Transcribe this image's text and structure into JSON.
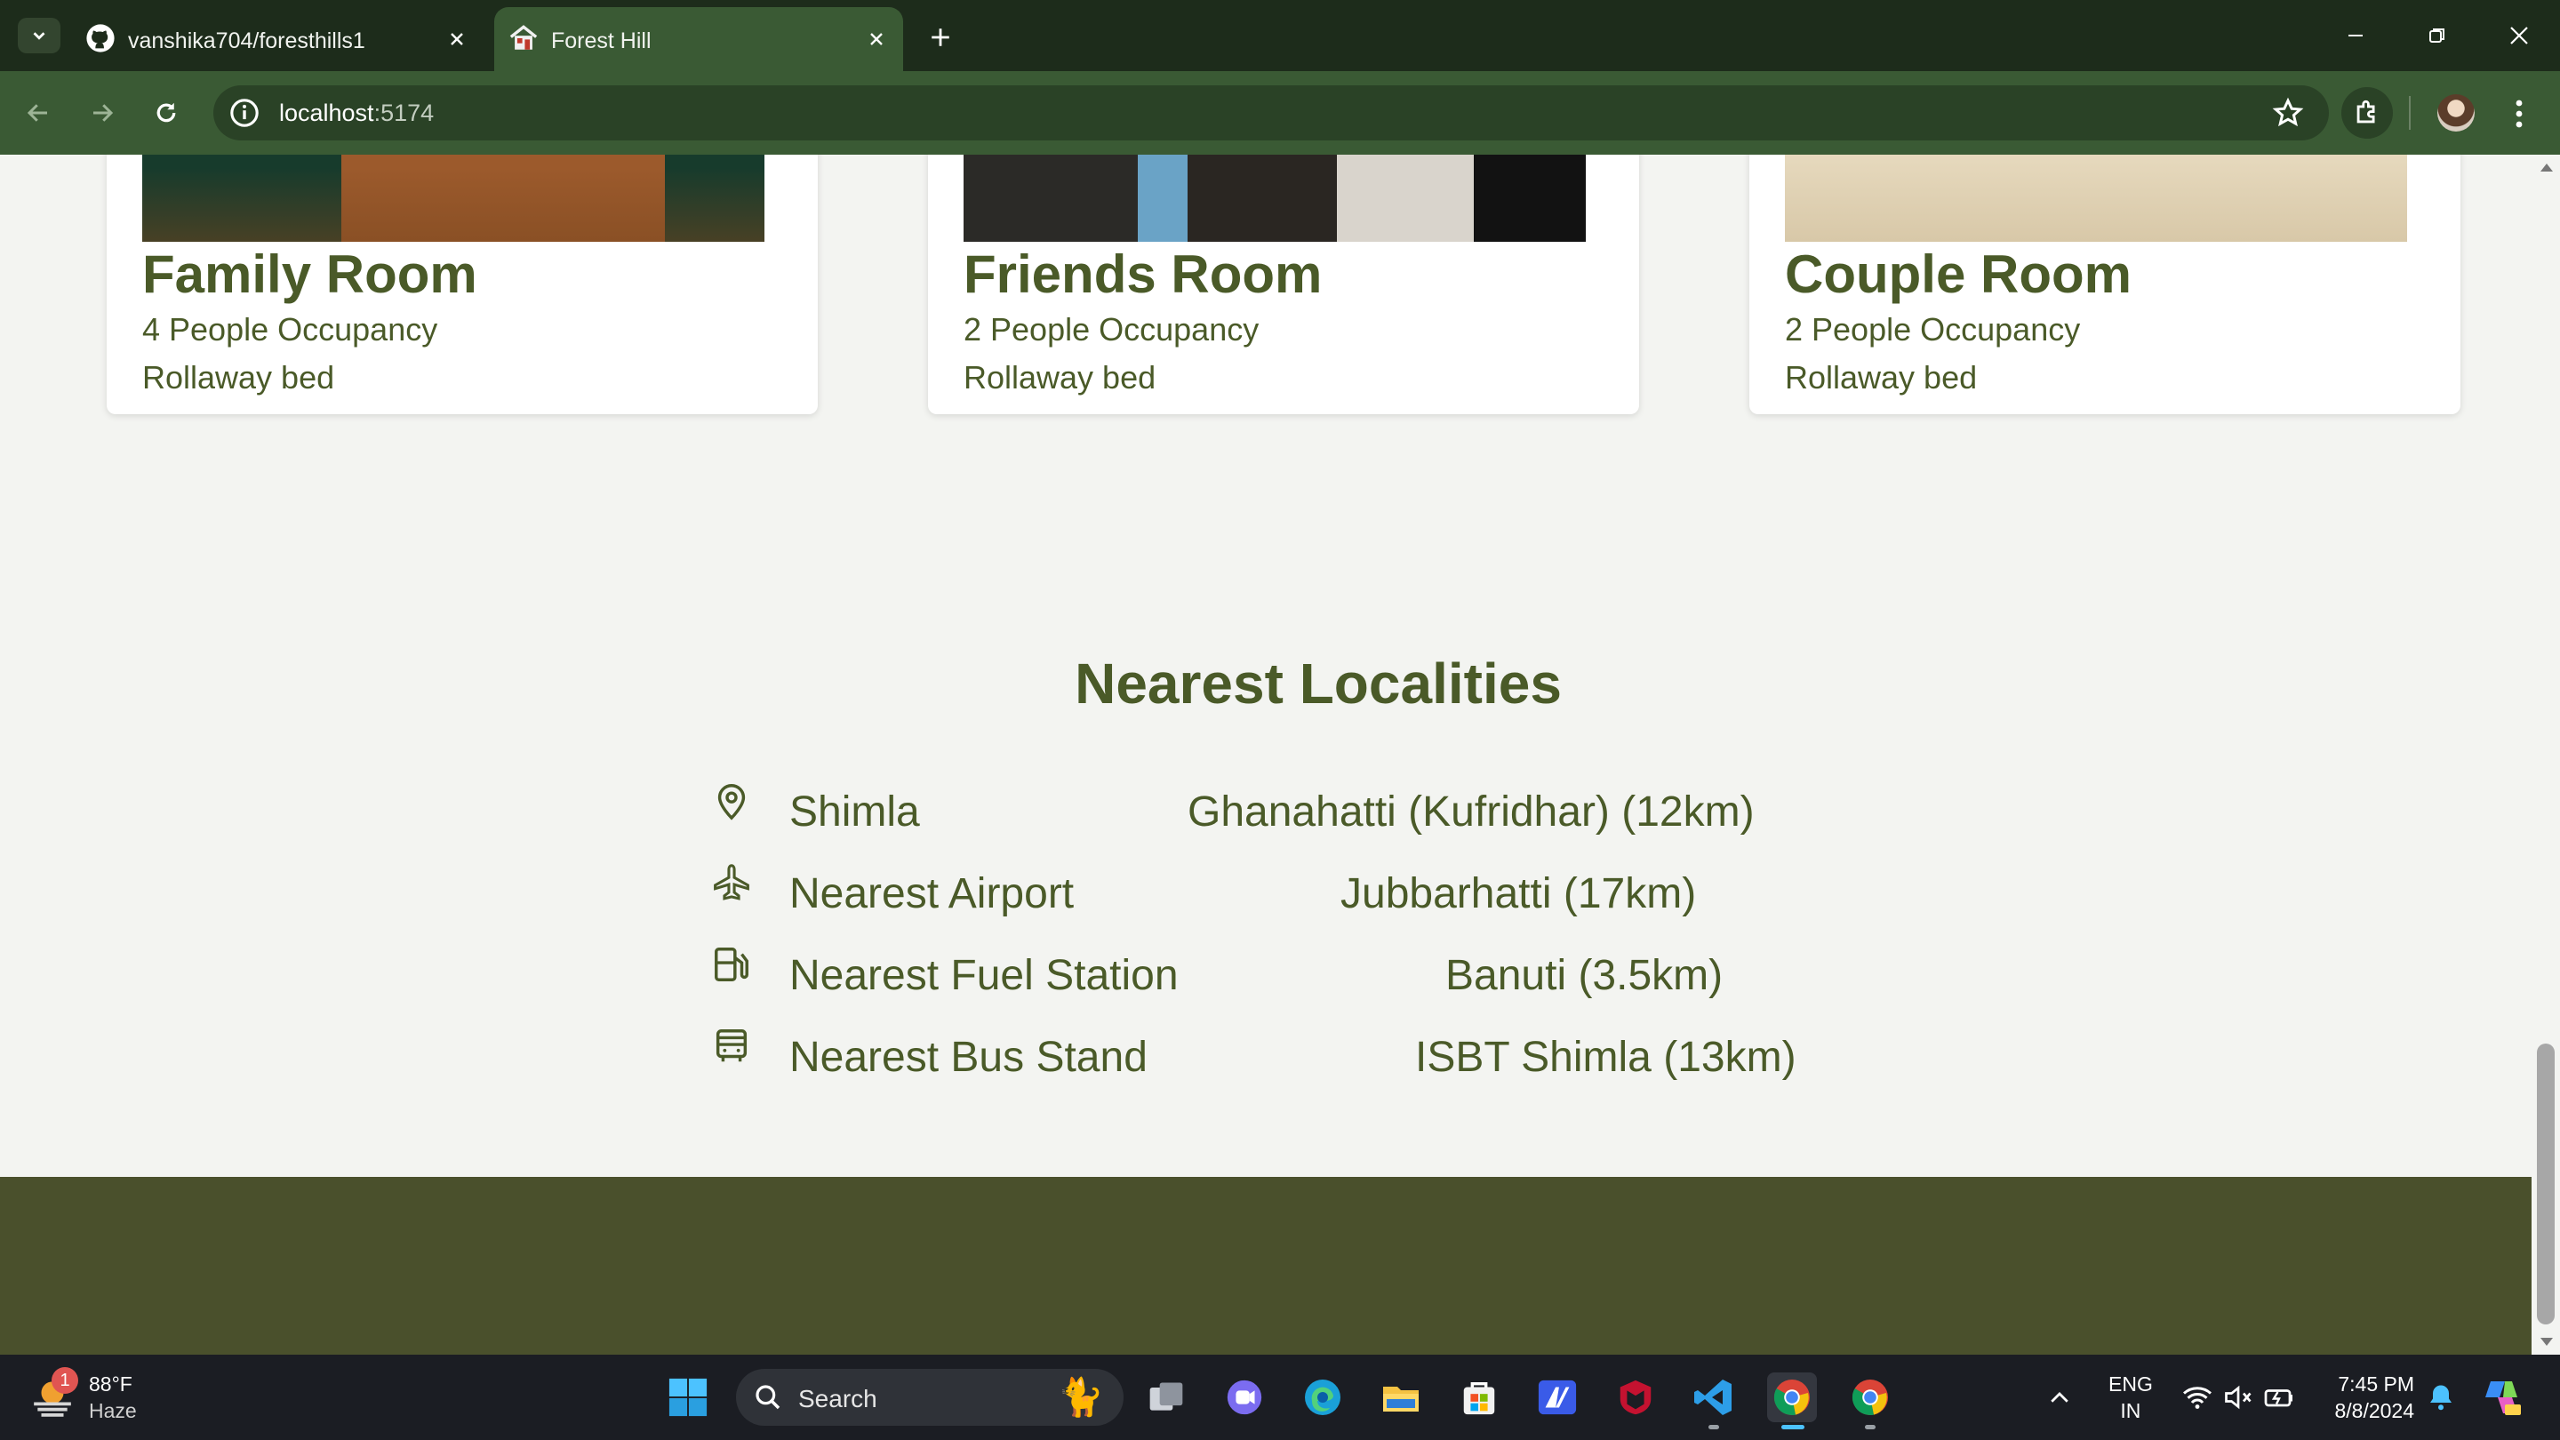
{
  "browser": {
    "tabs": [
      {
        "title": "vanshika704/foresthills1",
        "icon": "github-icon",
        "active": false
      },
      {
        "title": "Forest Hill",
        "icon": "house-icon",
        "active": true
      }
    ],
    "address": {
      "host": "localhost",
      "port": ":5174"
    }
  },
  "rooms": [
    {
      "name": "Family Room",
      "occupancy": "4 People Occupancy",
      "bed": "Rollaway bed"
    },
    {
      "name": "Friends Room",
      "occupancy": "2 People Occupancy",
      "bed": "Rollaway bed"
    },
    {
      "name": "Couple Room",
      "occupancy": "2 People Occupancy",
      "bed": "Rollaway bed"
    }
  ],
  "localities": {
    "title": "Nearest Localities",
    "items": [
      {
        "icon": "map-pin-icon",
        "label": "Shimla",
        "value": "Ghanahatti (Kufridhar) (12km)"
      },
      {
        "icon": "airplane-icon",
        "label": "Nearest Airport",
        "value": "Jubbarhatti (17km)"
      },
      {
        "icon": "fuel-station-icon",
        "label": "Nearest Fuel Station",
        "value": "Banuti (3.5km)"
      },
      {
        "icon": "bus-icon",
        "label": "Nearest Bus Stand",
        "value": "ISBT Shimla (13km)"
      }
    ]
  },
  "taskbar": {
    "weather": {
      "temp": "88°F",
      "desc": "Haze",
      "badge": "1"
    },
    "search_label": "Search",
    "language": {
      "line1": "ENG",
      "line2": "IN"
    },
    "clock": {
      "time": "7:45 PM",
      "date": "8/8/2024"
    }
  },
  "colors": {
    "brand_green": "#4a5a28",
    "footer": "#4a502c",
    "chrome_toolbar": "#3a5a34",
    "chrome_tabbar": "#1d2c1b"
  }
}
